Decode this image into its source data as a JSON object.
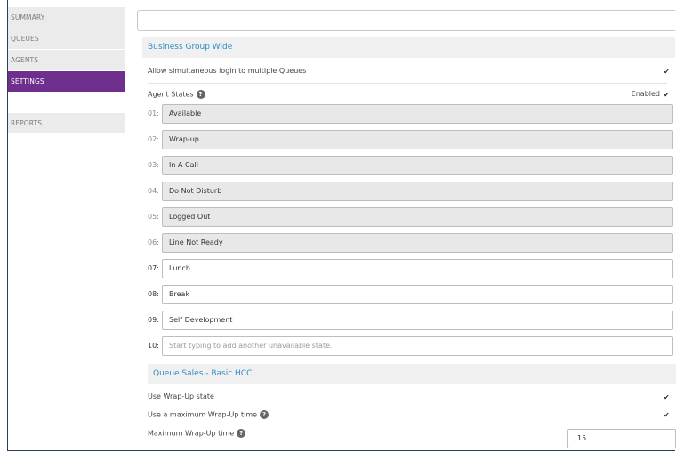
{
  "sidebar": {
    "items": [
      {
        "label": "SUMMARY"
      },
      {
        "label": "QUEUES"
      },
      {
        "label": "AGENTS"
      },
      {
        "label": "SETTINGS"
      },
      {
        "label": "REPORTS"
      }
    ]
  },
  "business_group": {
    "header": "Business Group Wide",
    "allow_login_label": "Allow simultaneous login to multiple Queues",
    "agent_states_label": "Agent States",
    "help_glyph": "?",
    "enabled_label": "Enabled",
    "checkmark": "✔"
  },
  "agent_states": [
    {
      "num": "01:",
      "label": "Available"
    },
    {
      "num": "02:",
      "label": "Wrap-up"
    },
    {
      "num": "03:",
      "label": "In A Call"
    },
    {
      "num": "04:",
      "label": "Do Not Disturb"
    },
    {
      "num": "05:",
      "label": "Logged Out"
    },
    {
      "num": "06:",
      "label": "Line Not Ready"
    },
    {
      "num": "07:",
      "label": "Lunch"
    },
    {
      "num": "08:",
      "label": "Break"
    },
    {
      "num": "09:",
      "label": "Self Development"
    },
    {
      "num": "10:",
      "placeholder": "Start typing to add another unavailable state."
    }
  ],
  "queue_sales": {
    "header": "Queue Sales - Basic HCC",
    "use_wrapup_label": "Use Wrap-Up state",
    "use_max_wrapup_label": "Use a maximum Wrap-Up time",
    "max_wrapup_label": "Maximum Wrap-Up time",
    "max_wrapup_value": "15"
  },
  "colors": {
    "accent_purple": "#6e2f8d",
    "header_blue": "#2e8dc6"
  }
}
